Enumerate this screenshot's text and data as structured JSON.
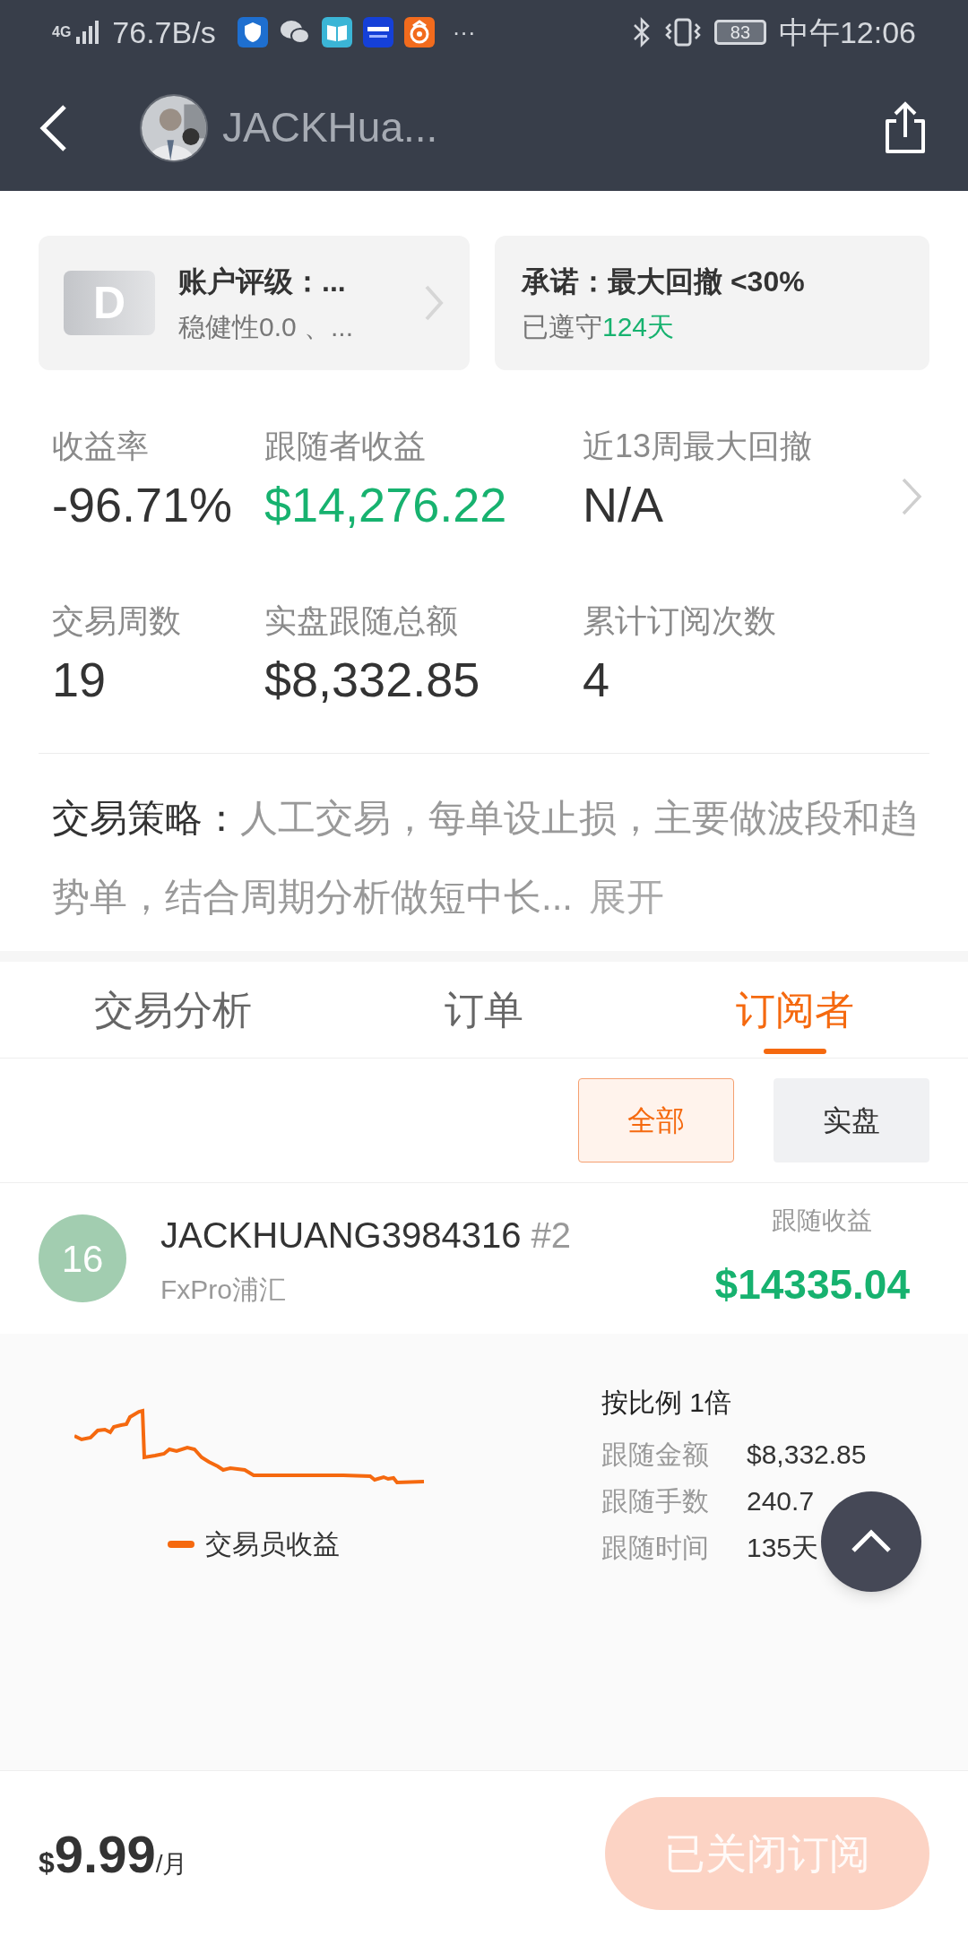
{
  "status_bar": {
    "network": "4G",
    "speed": "76.7B/s",
    "more": "···",
    "battery": "83",
    "time": "中午12:06"
  },
  "header": {
    "title": "JACKHua..."
  },
  "rating_card": {
    "badge": "D",
    "title": "账户评级：...",
    "subtitle": "稳健性0.0 、..."
  },
  "promise_card": {
    "title": "承诺：最大回撤 <30%",
    "prefix": "已遵守",
    "days": "124天"
  },
  "stats": [
    {
      "label": "收益率",
      "value": "-96.71%",
      "color": "#333333"
    },
    {
      "label": "跟随者收益",
      "value": "$14,276.22",
      "color": "#17b26f"
    },
    {
      "label": "近13周最大回撤",
      "value": "N/A",
      "color": "#333333"
    },
    {
      "label": "交易周数",
      "value": "19",
      "color": "#333333"
    },
    {
      "label": "实盘跟随总额",
      "value": "$8,332.85",
      "color": "#333333"
    },
    {
      "label": "累计订阅次数",
      "value": "4",
      "color": "#333333"
    }
  ],
  "strategy": {
    "label": "交易策略：",
    "text": "人工交易，每单设止损，主要做波段和趋势单，结合周期分析做短中长...",
    "more": "展开"
  },
  "tabs": [
    {
      "label": "交易分析",
      "selected": false
    },
    {
      "label": "订单",
      "selected": false
    },
    {
      "label": "订阅者",
      "selected": true
    }
  ],
  "filters": [
    {
      "label": "全部",
      "selected": true
    },
    {
      "label": "实盘",
      "selected": false
    }
  ],
  "subscriber": {
    "rank": "16",
    "name": "JACKHUANG3984316",
    "tag": "#2",
    "broker": "FxPro浦汇",
    "profit_label": "跟随收益",
    "profit": "$14335.04"
  },
  "chart": {
    "legend": "交易员收益"
  },
  "details": {
    "title": "按比例 1倍",
    "rows": [
      {
        "label": "跟随金额",
        "value": "$8,332.85"
      },
      {
        "label": "跟随手数",
        "value": "240.7"
      },
      {
        "label": "跟随时间",
        "value": "135天"
      }
    ]
  },
  "footer": {
    "currency": "$",
    "price": "9.99",
    "unit": "/月",
    "button": "已关闭订阅",
    "disabled": true
  }
}
